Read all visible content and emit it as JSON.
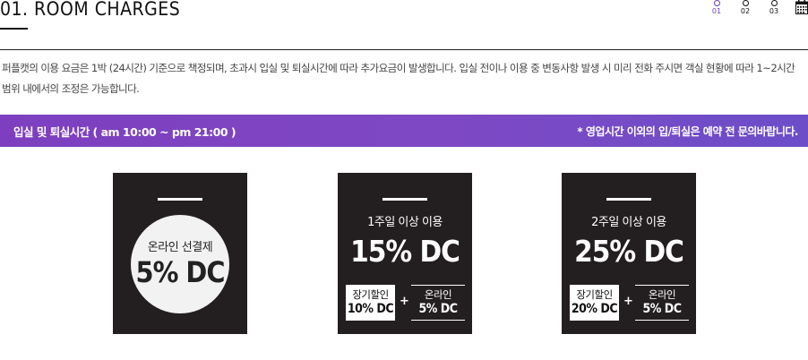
{
  "header": {
    "title": "01. ROOM CHARGES",
    "steps": [
      "01",
      "02",
      "03"
    ]
  },
  "description": "퍼플캣의 이용 요금은 1박 (24시간) 기준으로 책정되며, 초과시 입실 및 퇴실시간에 따라 추가요금이 발생합니다.  입실 전이나 이용 중 변동사항 발생 시 미리 전화 주시면 객실 현황에 따라 1~2시간 범위 내에서의 조정은 가능합니다.",
  "banner": {
    "left": "입실 및 퇴실시간 ( am 10:00 ~ pm 21:00 )",
    "right": "* 영업시간 이외의 입/퇴실은 예약 전 문의바랍니다."
  },
  "cards": [
    {
      "sub": "온라인 선결제",
      "big": "5% DC"
    },
    {
      "sub": "1주일 이상 이용",
      "big": "15% DC",
      "box1": {
        "a": "장기할인",
        "b": "10% DC"
      },
      "plus": "+",
      "box2": {
        "a": "온라인",
        "b": "5% DC"
      }
    },
    {
      "sub": "2주일 이상 이용",
      "big": "25% DC",
      "box1": {
        "a": "장기할인",
        "b": "20% DC"
      },
      "plus": "+",
      "box2": {
        "a": "온라인",
        "b": "5% DC"
      }
    }
  ],
  "colors": {
    "accent": "#7d3fbf",
    "card": "#231f20"
  }
}
